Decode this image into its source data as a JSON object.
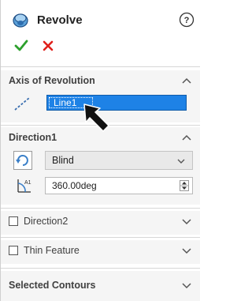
{
  "header": {
    "title": "Revolve",
    "icon": "revolve-icon",
    "help_icon": "help-icon"
  },
  "actions": {
    "ok_icon": "checkmark-icon",
    "cancel_icon": "close-icon",
    "ok_color": "#2ca02c",
    "cancel_color": "#e0201b"
  },
  "axis_section": {
    "title": "Axis of Revolution",
    "value": "Line1",
    "selected_color": "#1e82e6",
    "icon": "axis-line-icon"
  },
  "direction1": {
    "title": "Direction1",
    "end_condition": "Blind",
    "angle": "360.00deg",
    "icon_reverse": "reverse-direction-icon",
    "icon_angle": "angle-icon"
  },
  "direction2": {
    "label": "Direction2",
    "checked": false
  },
  "thin_feature": {
    "label": "Thin Feature",
    "checked": false
  },
  "selected_contours": {
    "title": "Selected Contours"
  }
}
